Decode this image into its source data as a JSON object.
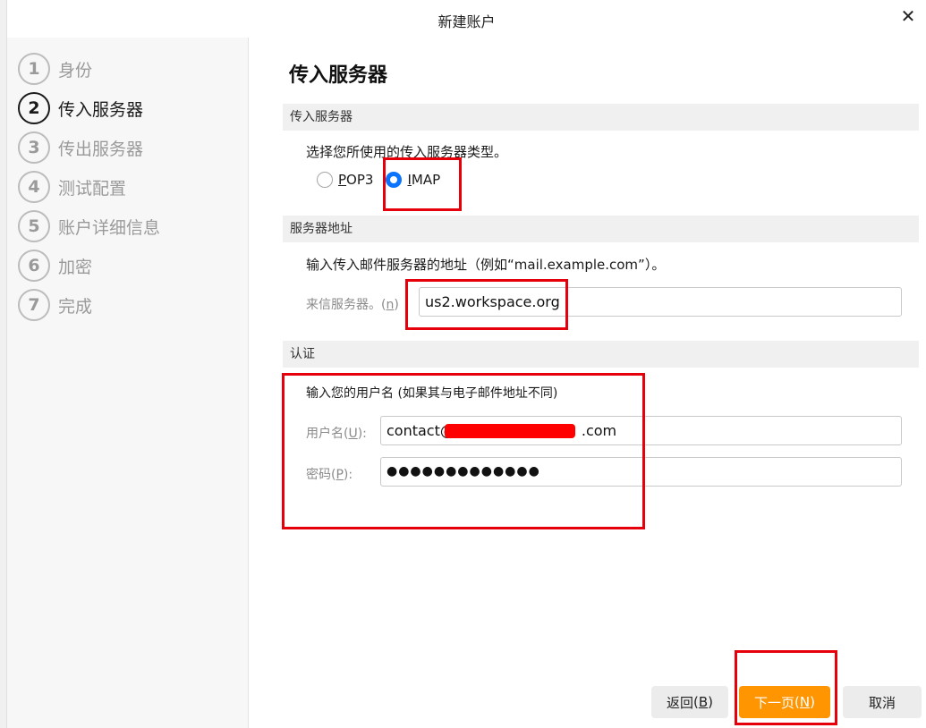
{
  "window": {
    "title": "新建账户",
    "close_icon": "close-icon"
  },
  "steps": [
    {
      "num": "1",
      "label": "身份",
      "active": false
    },
    {
      "num": "2",
      "label": "传入服务器",
      "active": true
    },
    {
      "num": "3",
      "label": "传出服务器",
      "active": false
    },
    {
      "num": "4",
      "label": "测试配置",
      "active": false
    },
    {
      "num": "5",
      "label": "账户详细信息",
      "active": false
    },
    {
      "num": "6",
      "label": "加密",
      "active": false
    },
    {
      "num": "7",
      "label": "完成",
      "active": false
    }
  ],
  "main": {
    "title": "传入服务器",
    "incoming": {
      "header": "传入服务器",
      "prompt": "选择您所使用的传入服务器类型。",
      "options": [
        {
          "label": "POP3",
          "accel": "P",
          "rest": "OP3",
          "checked": false
        },
        {
          "label": "IMAP",
          "accel": "I",
          "rest": "MAP",
          "checked": true
        }
      ]
    },
    "server_address": {
      "header": "服务器地址",
      "prompt": "输入传入邮件服务器的地址（例如“mail.example.com”）。",
      "field_label": "来信服务器。",
      "field_accel": "n",
      "field_value": "us2.workspace.org"
    },
    "auth": {
      "header": "认证",
      "prompt": "输入您的用户名 (如果其与电子邮件地址不同)",
      "username_label": "用户名",
      "username_accel": "U",
      "username_prefix": "contact@",
      "username_suffix": ".com",
      "password_label": "密码",
      "password_accel": "P",
      "password_value": "●●●●●●●●●●●●●"
    }
  },
  "buttons": {
    "back": {
      "label": "返回",
      "accel": "B"
    },
    "next": {
      "label": "下一页",
      "accel": "N"
    },
    "cancel": {
      "label": "取消"
    }
  },
  "colors": {
    "accent": "#ff9500",
    "radio": "#0a74ff",
    "annotation": "#e5000b"
  }
}
